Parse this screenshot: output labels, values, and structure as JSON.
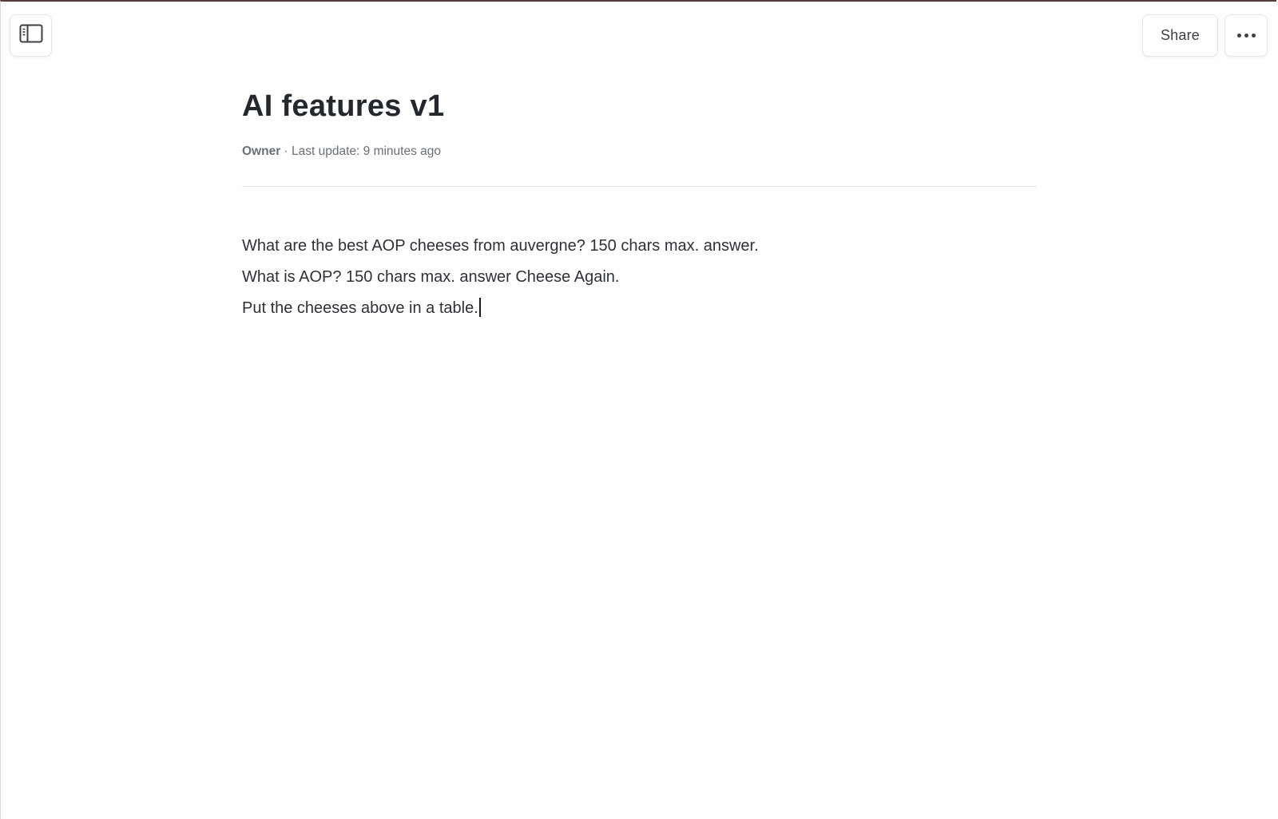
{
  "toolbar": {
    "sidebar_toggle_icon": "sidebar-panel-icon",
    "share_label": "Share",
    "more_icon": "more-horizontal-icon"
  },
  "document": {
    "title": "AI features v1",
    "meta": {
      "role": "Owner",
      "separator": " · ",
      "last_update": "Last update: 9 minutes ago"
    },
    "lines": [
      "What are the best AOP cheeses from auvergne? 150 chars max. answer.",
      "What is AOP? 150 chars max. answer Cheese Again.",
      "Put the cheeses above in a table."
    ]
  },
  "colors": {
    "title": "#24272c",
    "meta": "#6b6f76",
    "body_text": "#2e3136",
    "divider": "#e6e6e6",
    "top_border": "#5a3a3a"
  }
}
